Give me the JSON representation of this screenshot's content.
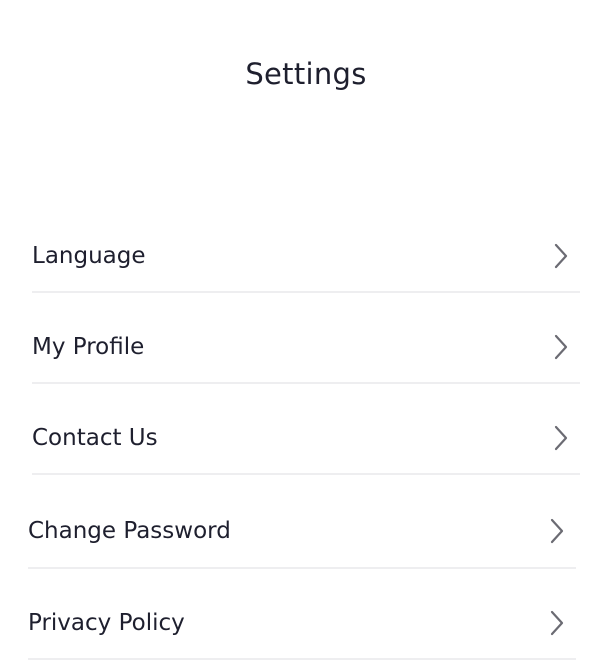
{
  "header": {
    "title": "Settings"
  },
  "settings": {
    "items": [
      {
        "label": "Language",
        "icon": "chevron-right-icon"
      },
      {
        "label": "My Profile",
        "icon": "chevron-right-icon"
      },
      {
        "label": "Contact Us",
        "icon": "chevron-right-icon"
      },
      {
        "label": "Change Password",
        "icon": "chevron-right-icon"
      },
      {
        "label": "Privacy Policy",
        "icon": "chevron-right-icon"
      }
    ]
  },
  "colors": {
    "text": "#1e1f2e",
    "chevron": "#6b6b73",
    "divider": "#eeeef0",
    "background": "#ffffff"
  }
}
